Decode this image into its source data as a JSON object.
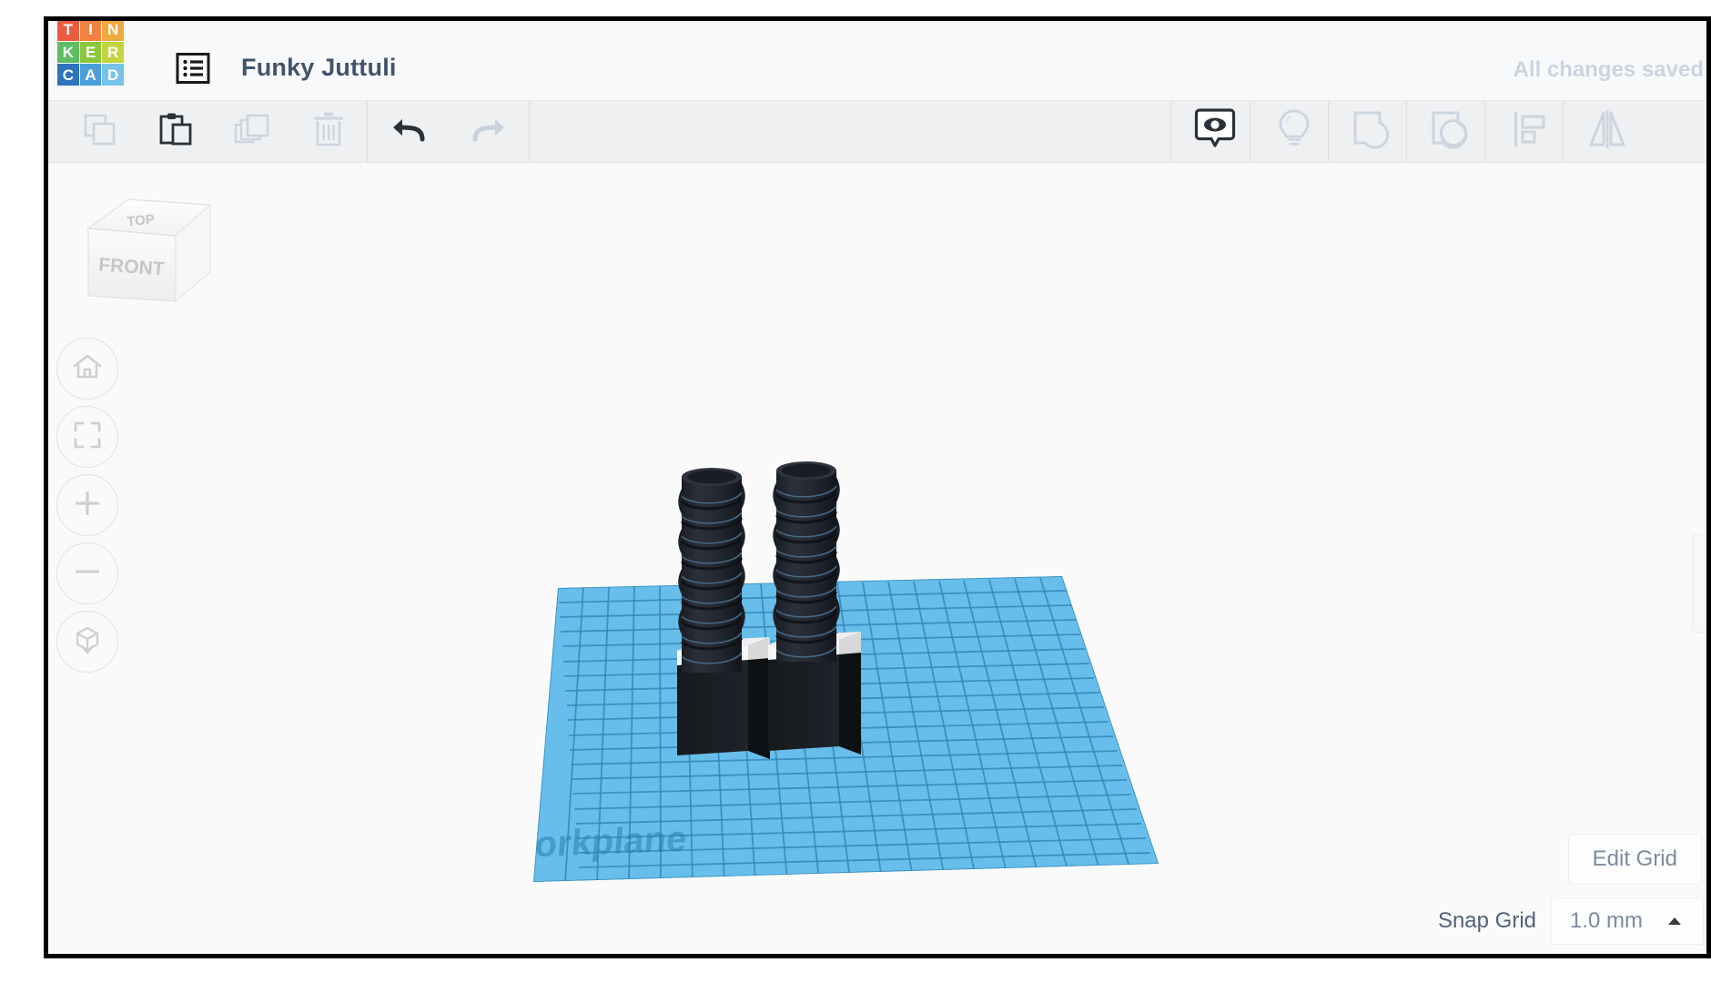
{
  "app": {
    "name": "Tinkercad",
    "logo_tiles": [
      {
        "letter": "T",
        "color": "#ea5b41"
      },
      {
        "letter": "I",
        "color": "#f0813f"
      },
      {
        "letter": "N",
        "color": "#f0a93f"
      },
      {
        "letter": "K",
        "color": "#5cbd63"
      },
      {
        "letter": "E",
        "color": "#8cc63f"
      },
      {
        "letter": "R",
        "color": "#c4d33e"
      },
      {
        "letter": "C",
        "color": "#2f72bd"
      },
      {
        "letter": "A",
        "color": "#4a9fd8"
      },
      {
        "letter": "D",
        "color": "#76c3e8"
      }
    ]
  },
  "header": {
    "doc_icon": "list-icon",
    "title": "Funky Juttuli",
    "save_status": "All changes saved"
  },
  "toolbar": {
    "left_items": [
      {
        "name": "copy",
        "label": "Copy",
        "enabled": false
      },
      {
        "name": "paste",
        "label": "Paste",
        "enabled": true
      },
      {
        "name": "duplicate",
        "label": "Duplicate",
        "enabled": false
      },
      {
        "name": "delete",
        "label": "Delete",
        "enabled": false
      }
    ],
    "history_items": [
      {
        "name": "undo",
        "label": "Undo",
        "enabled": true
      },
      {
        "name": "redo",
        "label": "Redo",
        "enabled": false
      }
    ],
    "right_items": [
      {
        "name": "show-hide",
        "label": "Show / Hide",
        "enabled": true
      },
      {
        "name": "light",
        "label": "Light",
        "enabled": false
      },
      {
        "name": "group",
        "label": "Group",
        "enabled": false
      },
      {
        "name": "ungroup",
        "label": "Ungroup",
        "enabled": false
      },
      {
        "name": "align",
        "label": "Align",
        "enabled": false
      },
      {
        "name": "mirror",
        "label": "Mirror",
        "enabled": false
      }
    ]
  },
  "viewcube": {
    "top_face": "TOP",
    "front_face": "FRONT"
  },
  "nav_buttons": [
    {
      "name": "home-view",
      "label": "Home view"
    },
    {
      "name": "fit-to-view",
      "label": "Fit all in view"
    },
    {
      "name": "zoom-in",
      "label": "Zoom in"
    },
    {
      "name": "zoom-out",
      "label": "Zoom out"
    },
    {
      "name": "view-mode",
      "label": "Switch to orthographic / perspective view"
    }
  ],
  "canvas": {
    "workplane_label": "Workplane",
    "grid_cells": 20,
    "plane_color": "#5bb8e8",
    "grid_line_color": "#2e7fae",
    "objects": [
      {
        "name": "helical-column-left",
        "type": "threaded-column",
        "color": "#22262b"
      },
      {
        "name": "helical-column-right",
        "type": "threaded-column",
        "color": "#22262b"
      },
      {
        "name": "box-base-left",
        "type": "box",
        "color": "#1d1f23"
      },
      {
        "name": "box-base-right",
        "type": "box",
        "color": "#1d1f23"
      }
    ]
  },
  "grid_controls": {
    "edit_grid_label": "Edit Grid",
    "snap_grid_label": "Snap Grid",
    "snap_grid_value": "1.0 mm",
    "caret": "caret-up-icon"
  }
}
